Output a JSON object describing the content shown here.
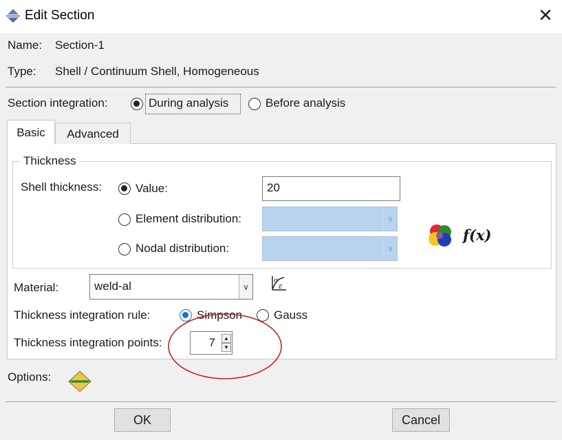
{
  "window": {
    "title": "Edit Section",
    "close_glyph": "✕",
    "icon": "abaqus-section-icon"
  },
  "section": {
    "name_label": "Name:",
    "name_value": "Section-1",
    "type_label": "Type:",
    "type_value": "Shell / Continuum Shell, Homogeneous"
  },
  "integration": {
    "label": "Section integration:",
    "options": [
      "During analysis",
      "Before analysis"
    ],
    "selected": "During analysis"
  },
  "tabs": [
    {
      "label": "Basic",
      "active": true
    },
    {
      "label": "Advanced",
      "active": false
    }
  ],
  "thickness": {
    "group_title": "Thickness",
    "shell_label": "Shell thickness:",
    "value_option": "Value:",
    "value": "20",
    "element_option": "Element distribution:",
    "nodal_option": "Nodal distribution:",
    "selected": "Value:",
    "fx_label": "f(x)",
    "icons": [
      "color-spheres-icon",
      "function-fx-icon"
    ]
  },
  "material": {
    "label": "Material:",
    "value": "weld-al",
    "icon": "material-editor-icon"
  },
  "integration_rule": {
    "label": "Thickness integration rule:",
    "options": [
      "Simpson",
      "Gauss"
    ],
    "selected": "Simpson",
    "accent": "#1a73c8"
  },
  "integration_points": {
    "label": "Thickness integration points:",
    "value": "7"
  },
  "options_row": {
    "label": "Options:",
    "icon": "diamond-options-icon"
  },
  "buttons": {
    "ok": "OK",
    "cancel": "Cancel"
  },
  "annotation": {
    "color": "#cc1f1f",
    "shape": "ellipse"
  }
}
